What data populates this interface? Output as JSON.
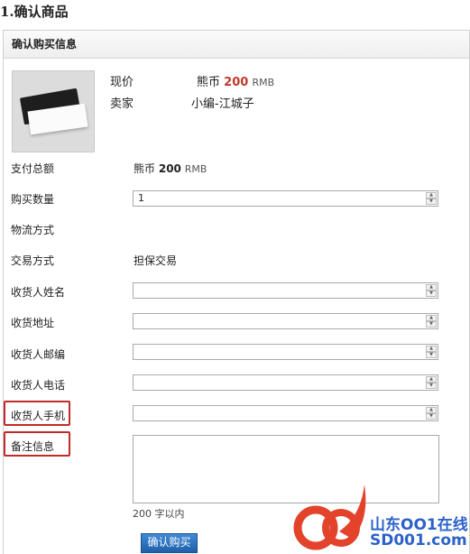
{
  "page_title": "1.确认商品",
  "panel": {
    "title": "确认购买信息",
    "product": {
      "price_label": "现价",
      "price_currency": "熊币",
      "price_value": "200",
      "price_unit": "RMB",
      "seller_label": "卖家",
      "seller_value": "小编-江城子"
    },
    "total": {
      "label": "支付总额",
      "currency": "熊币",
      "value": "200",
      "unit": "RMB"
    },
    "quantity": {
      "label": "购买数量",
      "value": "1"
    },
    "logistics": {
      "label": "物流方式"
    },
    "trade": {
      "label": "交易方式",
      "value": "担保交易"
    },
    "receiver_name": {
      "label": "收货人姓名",
      "value": ""
    },
    "address": {
      "label": "收货地址",
      "value": ""
    },
    "postcode": {
      "label": "收货人邮编",
      "value": ""
    },
    "phone": {
      "label": "收货人电话",
      "value": ""
    },
    "mobile": {
      "label": "收货人手机",
      "value": ""
    },
    "remark": {
      "label": "备注信息",
      "value": "",
      "hint": "200 字以内"
    },
    "submit_label": "确认购买"
  },
  "watermark": {
    "cn": "山东OO1在线",
    "en": "SD001.com"
  },
  "colors": {
    "highlight": "#c22a2a",
    "price": "#c0392b",
    "button": "#2a6ec0",
    "watermark": "#2b62c9",
    "watermark_accent": "#e3432b"
  }
}
